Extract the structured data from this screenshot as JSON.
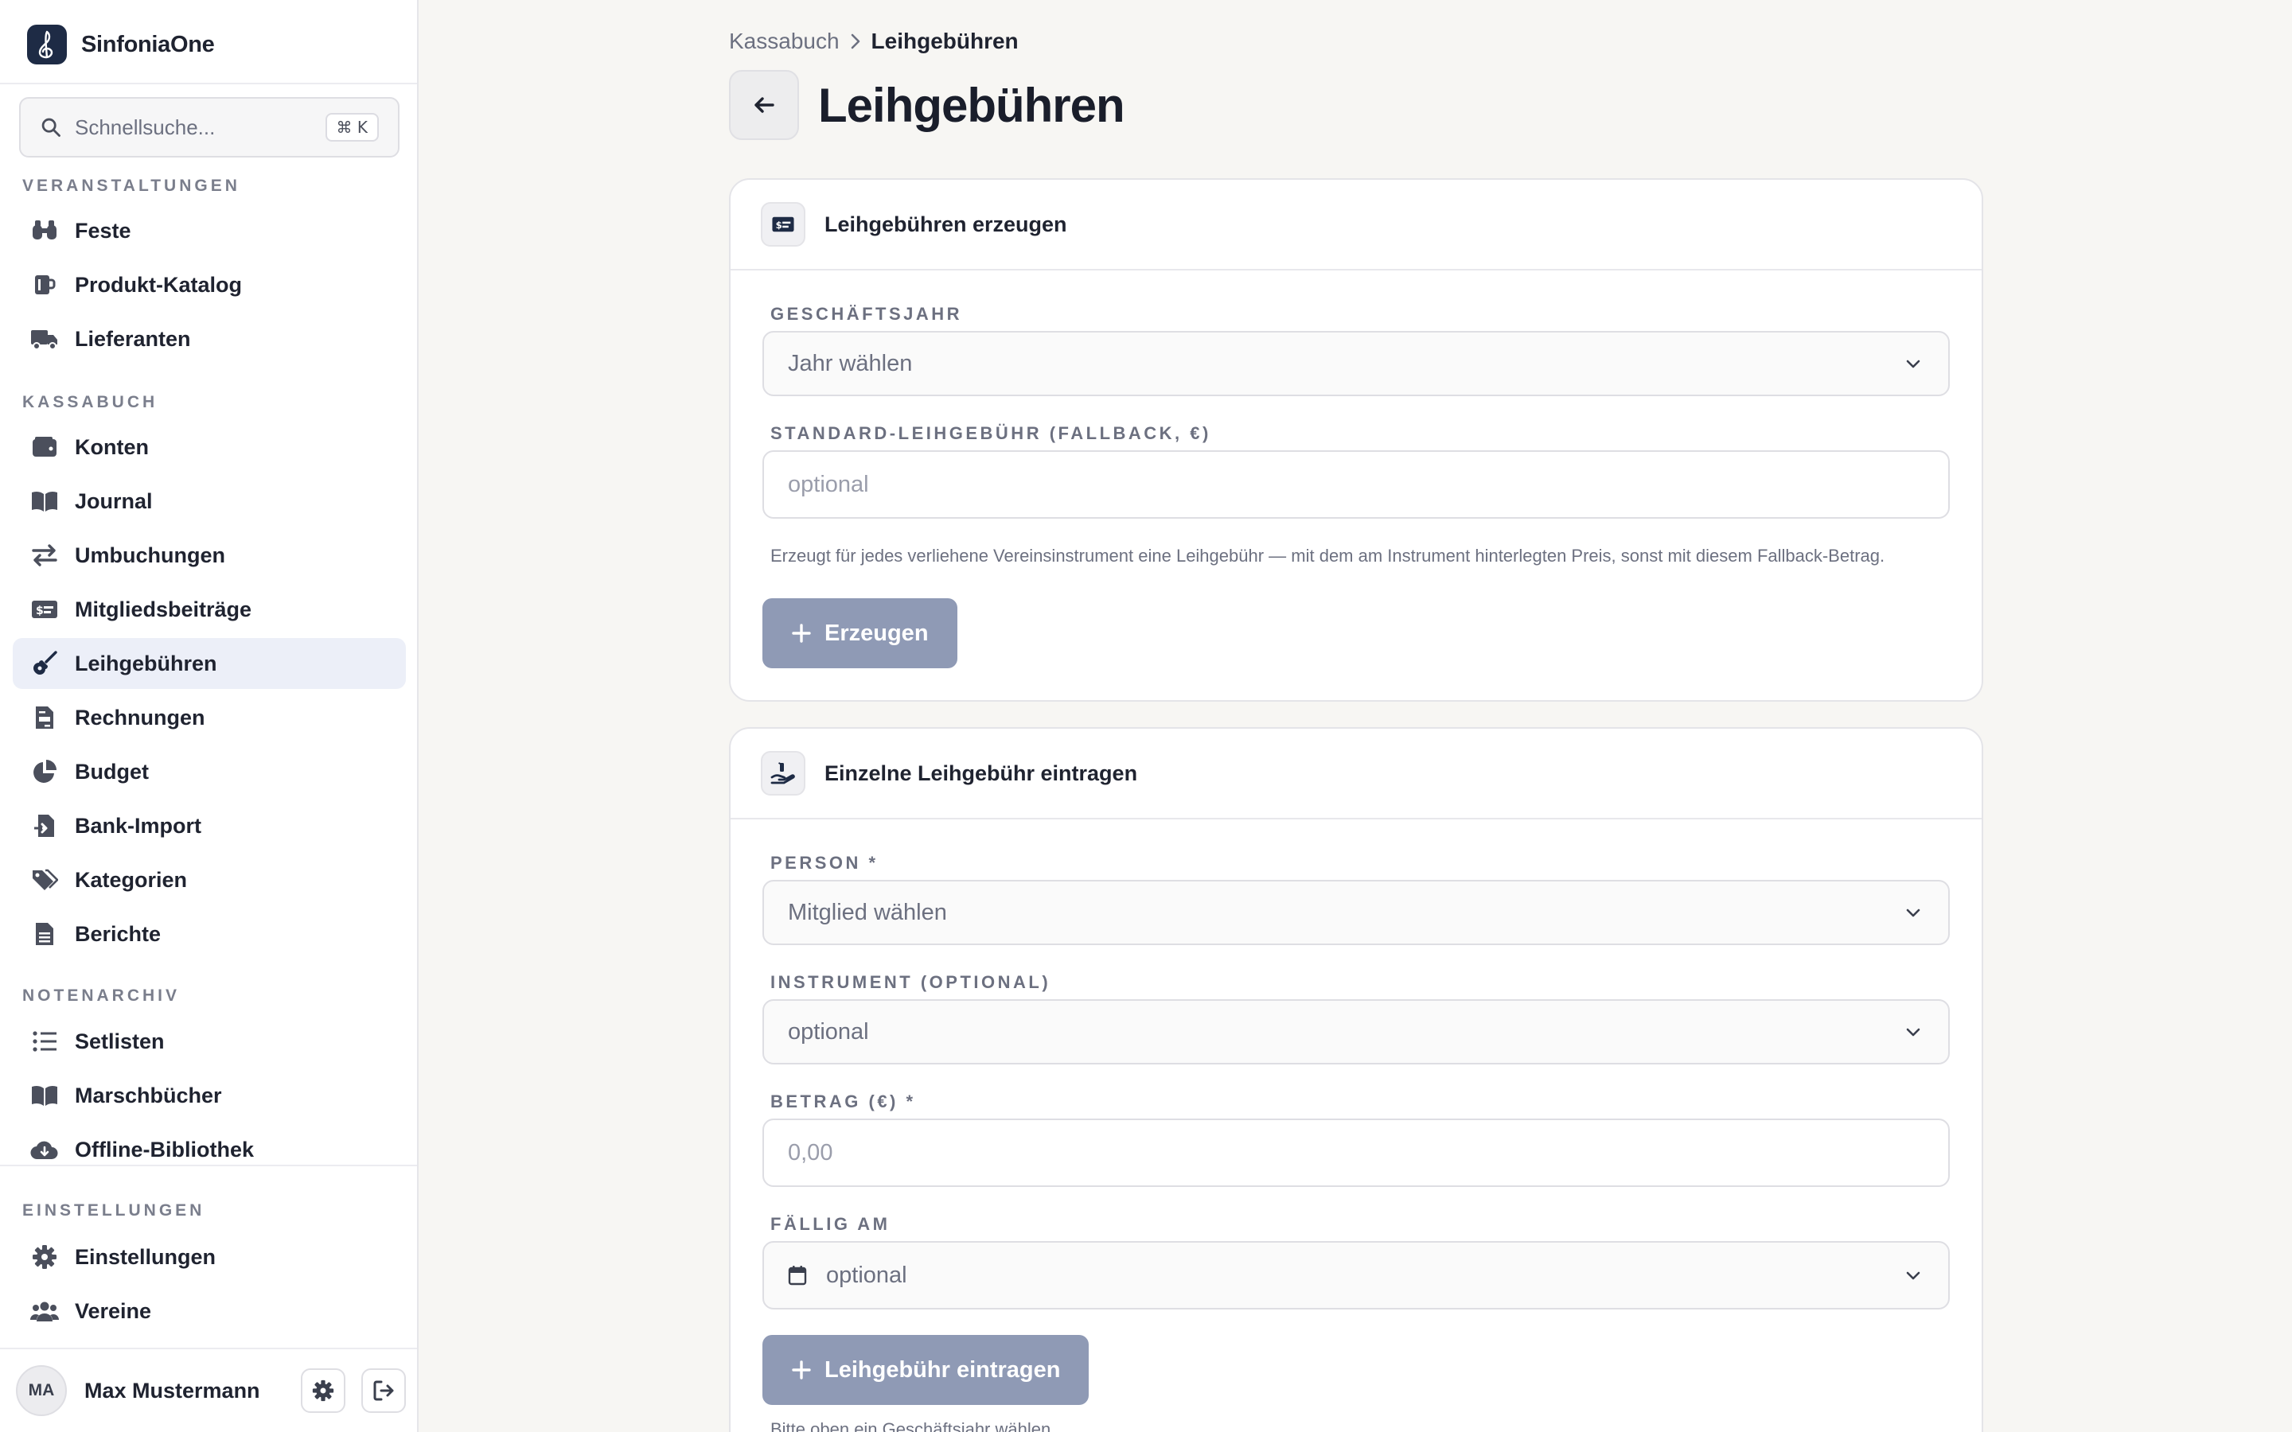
{
  "app": {
    "name": "SinfoniaOne"
  },
  "search": {
    "placeholder": "Schnellsuche...",
    "shortcut": "⌘ K"
  },
  "sidebar": {
    "sections": [
      {
        "title": "VERANSTALTUNGEN",
        "items": [
          {
            "label": "Feste",
            "icon": "binoculars-icon"
          },
          {
            "label": "Produkt-Katalog",
            "icon": "mug-icon"
          },
          {
            "label": "Lieferanten",
            "icon": "truck-icon"
          }
        ]
      },
      {
        "title": "KASSABUCH",
        "items": [
          {
            "label": "Konten",
            "icon": "wallet-icon"
          },
          {
            "label": "Journal",
            "icon": "book-open-icon"
          },
          {
            "label": "Umbuchungen",
            "icon": "arrows-left-right-icon"
          },
          {
            "label": "Mitgliedsbeiträge",
            "icon": "money-bill-icon"
          },
          {
            "label": "Leihgebühren",
            "icon": "guitar-icon",
            "active": true
          },
          {
            "label": "Rechnungen",
            "icon": "file-invoice-icon"
          },
          {
            "label": "Budget",
            "icon": "pie-chart-icon"
          },
          {
            "label": "Bank-Import",
            "icon": "file-import-icon"
          },
          {
            "label": "Kategorien",
            "icon": "tags-icon"
          },
          {
            "label": "Berichte",
            "icon": "file-lines-icon"
          }
        ]
      },
      {
        "title": "NOTENARCHIV",
        "items": [
          {
            "label": "Setlisten",
            "icon": "list-icon"
          },
          {
            "label": "Marschbücher",
            "icon": "book-open-icon"
          },
          {
            "label": "Offline-Bibliothek",
            "icon": "cloud-download-icon"
          }
        ]
      }
    ],
    "settings": {
      "title": "EINSTELLUNGEN",
      "items": [
        {
          "label": "Einstellungen",
          "icon": "gear-icon"
        },
        {
          "label": "Vereine",
          "icon": "users-icon"
        }
      ]
    },
    "user": {
      "initials": "MA",
      "name": "Max Mustermann"
    }
  },
  "breadcrumb": {
    "parent": "Kassabuch",
    "current": "Leihgebühren"
  },
  "page": {
    "title": "Leihgebühren"
  },
  "generate_card": {
    "title": "Leihgebühren erzeugen",
    "year_label": "GESCHÄFTSJAHR",
    "year_value": "Jahr wählen",
    "fee_label": "STANDARD-LEIHGEBÜHR (FALLBACK, €)",
    "fee_placeholder": "optional",
    "hint": "Erzeugt für jedes verliehene Vereinsinstrument eine Leihgebühr — mit dem am Instrument hinterlegten Preis, sonst mit diesem Fallback-Betrag.",
    "button": "Erzeugen"
  },
  "single_card": {
    "title": "Einzelne Leihgebühr eintragen",
    "person_label": "PERSON *",
    "person_value": "Mitglied wählen",
    "instrument_label": "INSTRUMENT (OPTIONAL)",
    "instrument_value": "optional",
    "amount_label": "BETRAG (€) *",
    "amount_placeholder": "0,00",
    "due_label": "FÄLLIG AM",
    "due_value": "optional",
    "button": "Leihgebühr eintragen",
    "hint": "Bitte oben ein Geschäftsjahr wählen."
  },
  "colors": {
    "accent": "#1e2b45",
    "button_disabled": "#8f9ab5",
    "active_nav": "#eceff8"
  }
}
